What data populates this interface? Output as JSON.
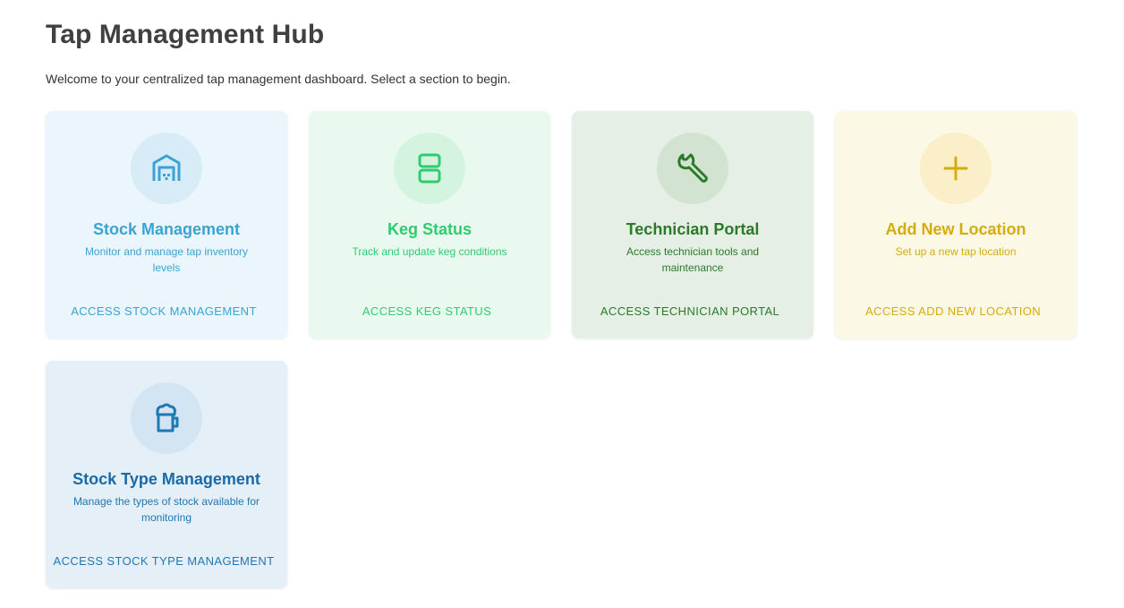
{
  "header": {
    "title": "Tap Management Hub",
    "subtitle": "Welcome to your centralized tap management dashboard. Select a section to begin."
  },
  "cards": [
    {
      "title": "Stock Management",
      "description": "Monitor and manage tap inventory levels",
      "action": "ACCESS STOCK MANAGEMENT",
      "icon": "warehouse-icon",
      "color": "#3aa3d4"
    },
    {
      "title": "Keg Status",
      "description": "Track and update keg conditions",
      "action": "ACCESS KEG STATUS",
      "icon": "storage-icon",
      "color": "#2ecc71"
    },
    {
      "title": "Technician Portal",
      "description": "Access technician tools and maintenance",
      "action": "ACCESS TECHNICIAN PORTAL",
      "icon": "wrench-icon",
      "color": "#2a7a2a"
    },
    {
      "title": "Add New Location",
      "description": "Set up a new tap location",
      "action": "ACCESS ADD NEW LOCATION",
      "icon": "plus-icon",
      "color": "#d4ac0d"
    },
    {
      "title": "Stock Type Management",
      "description": "Manage the types of stock available for monitoring",
      "action": "ACCESS STOCK TYPE MANAGEMENT",
      "icon": "beer-mug-icon",
      "color": "#1f77b4"
    }
  ]
}
